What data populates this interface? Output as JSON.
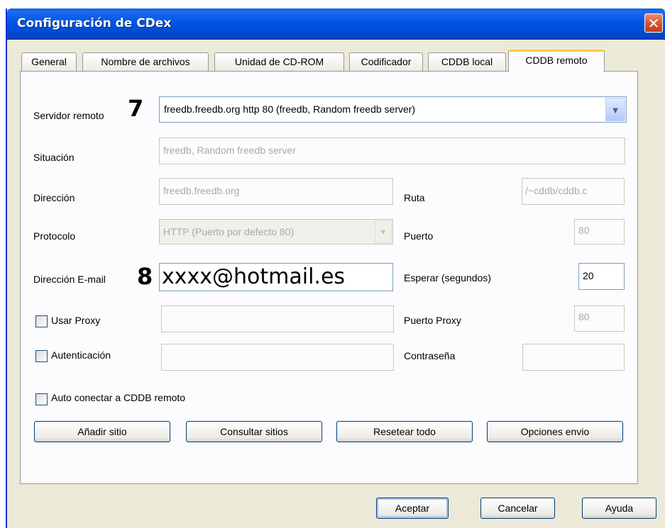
{
  "window": {
    "title": "Configuración de CDex",
    "close_symbol": "✕"
  },
  "tabs": [
    {
      "label": "General"
    },
    {
      "label": "Nombre de archivos"
    },
    {
      "label": "Unidad de CD-ROM"
    },
    {
      "label": "Codificador"
    },
    {
      "label": "CDDB local"
    },
    {
      "label": "CDDB remoto"
    }
  ],
  "active_tab": "CDDB remoto",
  "form": {
    "servidor_remoto": {
      "label": "Servidor remoto",
      "value": "freedb.freedb.org http  80  (freedb, Random freedb server)",
      "annotation": "7"
    },
    "situacion": {
      "label": "Situación",
      "value": "freedb, Random freedb server"
    },
    "direccion": {
      "label": "Dirección",
      "value": "freedb.freedb.org"
    },
    "ruta": {
      "label": "Ruta",
      "value": "/~cddb/cddb.c"
    },
    "protocolo": {
      "label": "Protocolo",
      "value": "HTTP (Puerto por defecto 80)"
    },
    "puerto": {
      "label": "Puerto",
      "value": "80"
    },
    "email": {
      "label": "Dirección E-mail",
      "value": "xxxx@hotmail.es",
      "annotation": "8"
    },
    "esperar": {
      "label": "Esperar (segundos)",
      "value": "20"
    },
    "usar_proxy": {
      "label": "Usar Proxy",
      "checked": false,
      "value": ""
    },
    "puerto_proxy": {
      "label": "Puerto Proxy",
      "value": "80"
    },
    "autenticacion": {
      "label": "Autenticación",
      "checked": false,
      "value": ""
    },
    "contrasena": {
      "label": "Contraseña",
      "value": ""
    },
    "auto_conectar": {
      "label": "Auto conectar a CDDB remoto",
      "checked": false
    }
  },
  "actions": {
    "add_site": "Añadir sitio",
    "query_sites": "Consultar sitios",
    "reset_all": "Resetear todo",
    "send_options": "Opciones envio"
  },
  "footer": {
    "ok": "Aceptar",
    "cancel": "Cancelar",
    "help": "Ayuda"
  },
  "colors": {
    "titlebar": "#0055e6",
    "active_tab_accent": "#ffc83c",
    "dialog_bg": "#ece9d8",
    "close_button": "#d5502b"
  }
}
